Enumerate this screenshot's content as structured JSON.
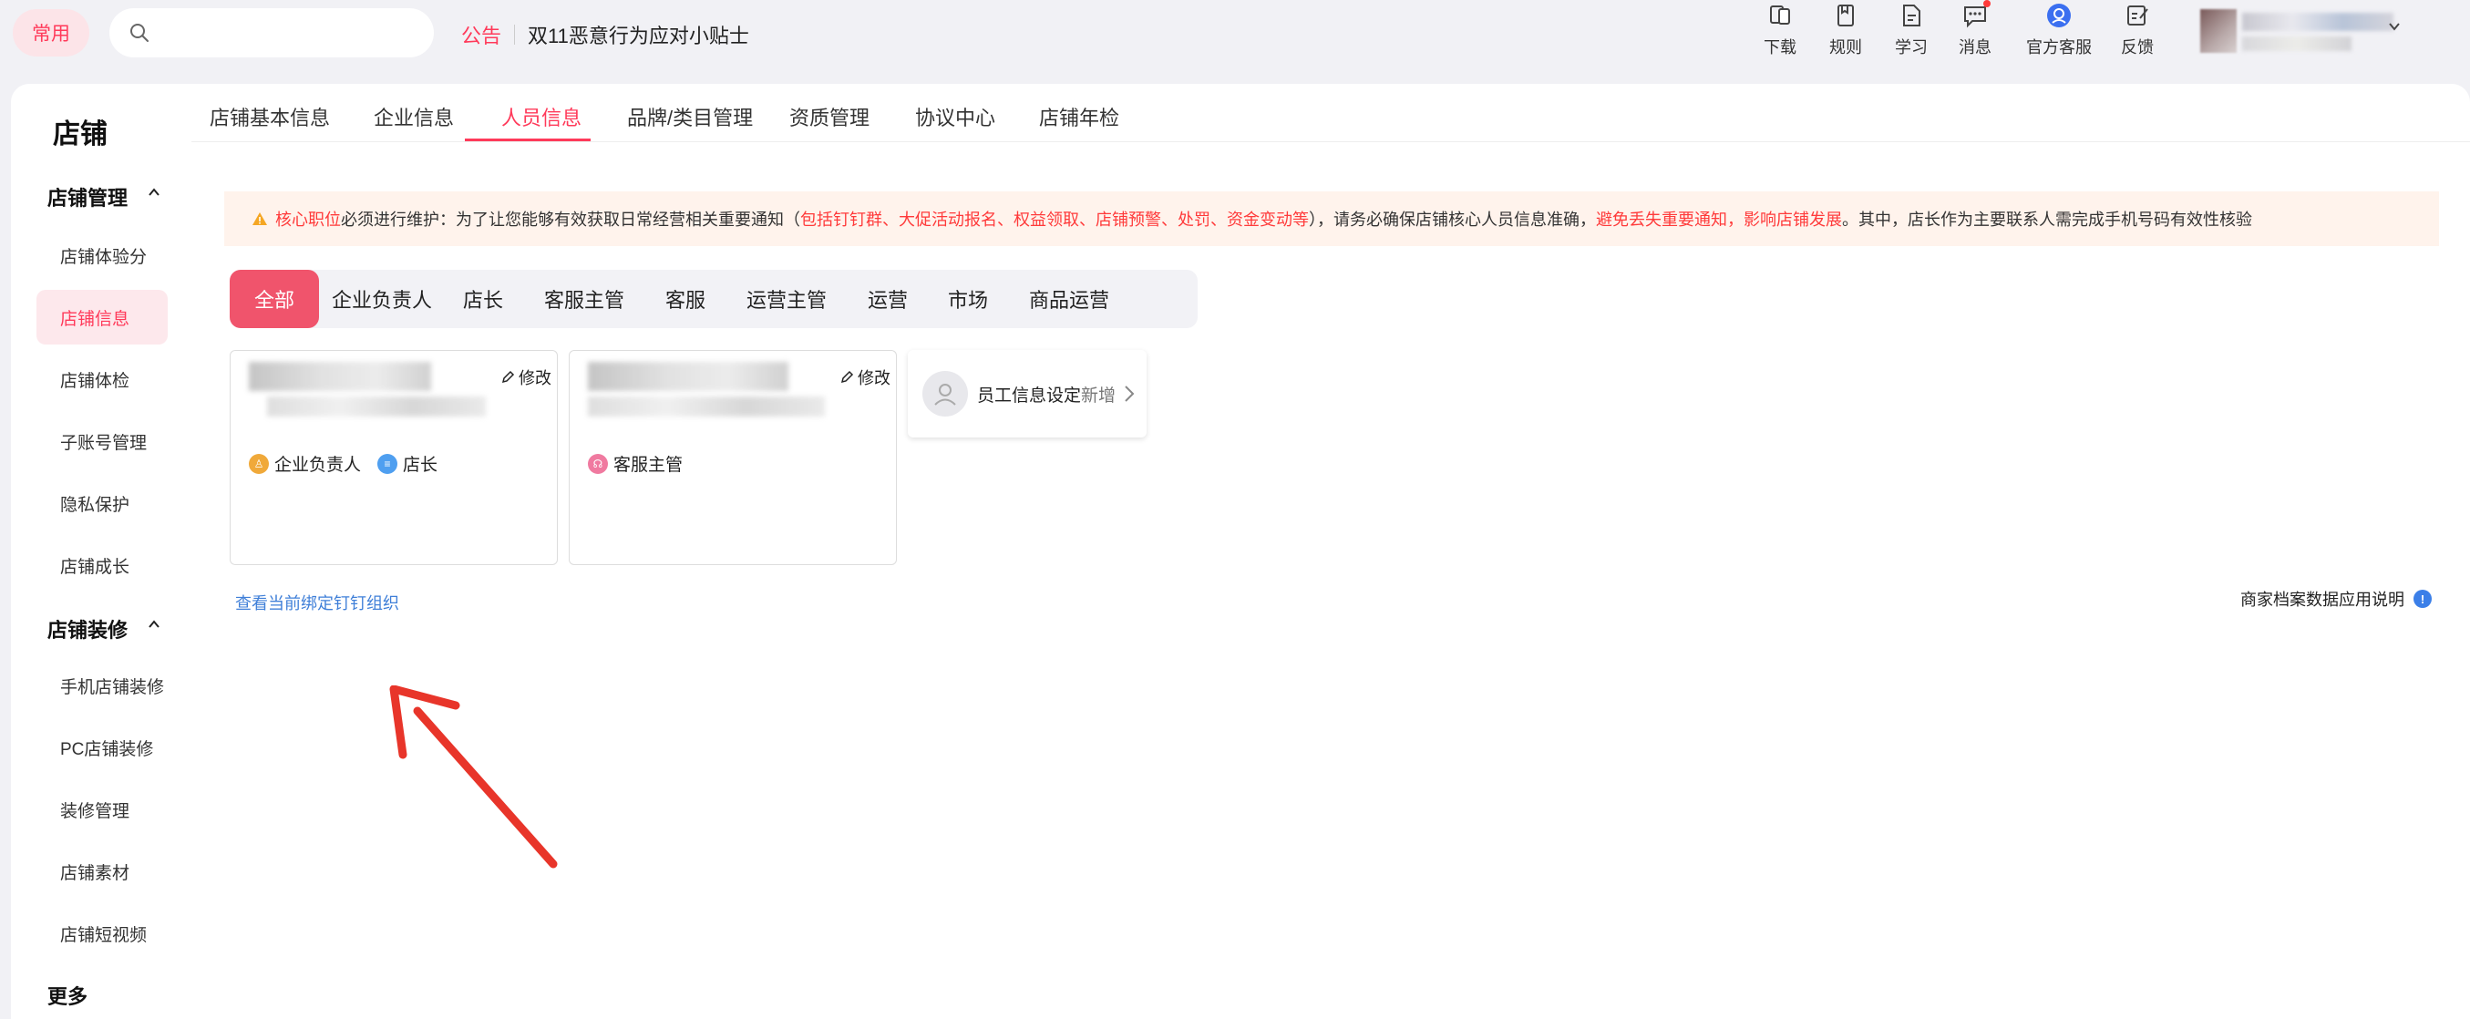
{
  "topbar": {
    "common_label": "常用",
    "search": {
      "placeholder": "",
      "icon": "search-icon"
    },
    "notice": {
      "tag": "公告",
      "text": "双11恶意行为应对小贴士"
    },
    "actions": [
      {
        "label": "下载",
        "icon": "download-icon"
      },
      {
        "label": "规则",
        "icon": "rules-icon"
      },
      {
        "label": "学习",
        "icon": "learn-icon"
      },
      {
        "label": "消息",
        "icon": "message-icon",
        "badge": true
      },
      {
        "label": "官方客服",
        "icon": "service-icon"
      },
      {
        "label": "反馈",
        "icon": "feedback-icon"
      }
    ]
  },
  "sidebar": {
    "title": "店铺",
    "groups": [
      {
        "label": "店铺管理",
        "items": [
          "店铺体验分",
          "店铺信息",
          "店铺体检",
          "子账号管理",
          "隐私保护",
          "店铺成长"
        ]
      },
      {
        "label": "店铺装修",
        "items": [
          "手机店铺装修",
          "PC店铺装修",
          "装修管理",
          "店铺素材",
          "店铺短视频"
        ]
      },
      {
        "label": "更多",
        "items": []
      }
    ],
    "active_item": "店铺信息"
  },
  "tabs": [
    "店铺基本信息",
    "企业信息",
    "人员信息",
    "品牌/类目管理",
    "资质管理",
    "协议中心",
    "店铺年检"
  ],
  "active_tab": "人员信息",
  "warning": {
    "part1": "核心职位",
    "part2": "必须进行维护：为了让您能够有效获取日常经营相关重要通知（",
    "part3": "包括钉钉群、大促活动报名、权益领取、店铺预警、处罚、资金变动等",
    "part4": "），请务必确保店铺核心人员信息准确，",
    "part5": "避免丢失重要通知，影响店铺发展",
    "part6": "。其中，店长作为主要联系人需完成手机号码有效性核验"
  },
  "filters": [
    "全部",
    "企业负责人",
    "店长",
    "客服主管",
    "客服",
    "运营主管",
    "运营",
    "市场",
    "商品运营"
  ],
  "active_filter": "全部",
  "cards": [
    {
      "edit_label": "修改",
      "roles": [
        {
          "label": "企业负责人",
          "color": "#f0a93a"
        },
        {
          "label": "店长",
          "color": "#4f9ff0"
        }
      ]
    },
    {
      "edit_label": "修改",
      "roles": [
        {
          "label": "客服主管",
          "color": "#f07aa0"
        }
      ]
    }
  ],
  "add_card": {
    "label": "员工信息设定",
    "action": "新增"
  },
  "links": {
    "dingtalk": "查看当前绑定钉钉组织",
    "archive": "商家档案数据应用说明",
    "info_icon_text": "!"
  },
  "colors": {
    "accent": "#ff3a5a",
    "link": "#3f7fd8",
    "warn_bg": "#fff3ec",
    "arrow": "#e8352a"
  }
}
